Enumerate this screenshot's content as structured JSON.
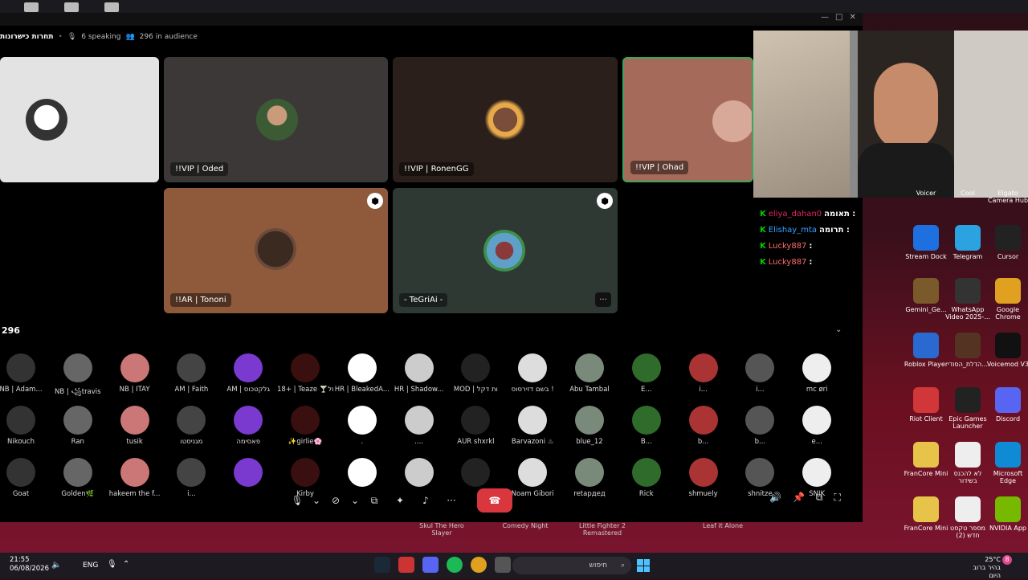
{
  "voice": {
    "channel_name": "תחרות כישרונות",
    "speaking": "6 speaking",
    "audience": "296 in audience"
  },
  "stage_tiles": [
    {
      "label": "",
      "bg": "#e3e3e3"
    },
    {
      "label": "!!VIP | Oded",
      "bg": "#3c3838"
    },
    {
      "label": "!!VIP | RonenGG",
      "bg": "#2a1f1a"
    },
    {
      "label": "!!VIP | Ohad",
      "bg": "#a66a5a"
    },
    {
      "label": "!!AR | Tononi",
      "bg": "#8f5a3c"
    },
    {
      "label": "- TeGriAi -",
      "bg": "#2f3934"
    }
  ],
  "audience_count": "296",
  "audience": [
    "NB | Adam...",
    "NB | ꧁travis",
    "NB | ITAY",
    "AM | Faith",
    "AM | גלקטכוס",
    "18+ | Teaze 🍸יזל",
    "HR | BleakedA...",
    "HR | Shadow...",
    "MOD | ות דקל",
    "בשם דזירסוס !",
    "Abu Tambal",
    "E...",
    "i...",
    "i...",
    "mc øri",
    "Nikouch",
    "Ran",
    "tusik",
    "מגניסטו",
    "פאסימה",
    "✨girlie🌸",
    ".",
    "....",
    "AUR shxrkl",
    "Barvazoni ♨",
    "blue_12",
    "B...",
    "b...",
    "b...",
    "e...",
    "Goat",
    "Golden🌿",
    "hakeem the f...",
    "i...",
    "",
    "Kirby",
    "",
    "",
    "",
    "Noam Gibori",
    "retapдед",
    "Rick",
    "shmuely",
    "shnitze",
    "SNIK"
  ],
  "chat": [
    {
      "badge": "תאומה :",
      "user": "eliya_dahan0",
      "color": "#e0245e"
    },
    {
      "badge": "תרומה :",
      "user": "Elishay_mta",
      "color": "#3aa0ff"
    },
    {
      "badge": ":",
      "user": "Lucky887",
      "color": "#ff6b6b"
    },
    {
      "badge": ":",
      "user": "Lucky887",
      "color": "#ff6b6b"
    }
  ],
  "desktop_icons": [
    {
      "label": "Voicer",
      "color": "#444"
    },
    {
      "label": "Cool",
      "color": "#444"
    },
    {
      "label": "Elgato Camera Hub",
      "color": "#333"
    },
    {
      "label": "Stream Dock",
      "color": "#1e6fe0"
    },
    {
      "label": "Telegram",
      "color": "#2aa3e0"
    },
    {
      "label": "Cursor",
      "color": "#222"
    },
    {
      "label": "Gemini_Ge...",
      "color": "#7a5a2a"
    },
    {
      "label": "WhatsApp Video 2025-...",
      "color": "#333"
    },
    {
      "label": "Google Chrome",
      "color": "#e0a020"
    },
    {
      "label": "Roblox Player",
      "color": "#2a6ad0"
    },
    {
      "label": "הדלת_הסודי...",
      "color": "#553322"
    },
    {
      "label": "Voicemod V3",
      "color": "#111"
    },
    {
      "label": "Riot Client",
      "color": "#d13639"
    },
    {
      "label": "Epic Games Launcher",
      "color": "#222"
    },
    {
      "label": "Discord",
      "color": "#5865f2"
    },
    {
      "label": "FranCore Mini",
      "color": "#e8c34a"
    },
    {
      "label": "לא להכנס בשידור",
      "color": "#eee"
    },
    {
      "label": "Microsoft Edge",
      "color": "#0f8ad4"
    },
    {
      "label": "FranCore Mini",
      "color": "#e8c34a"
    },
    {
      "label": "מספר טקסט חדש (2)",
      "color": "#eee"
    },
    {
      "label": "NVIDIA App",
      "color": "#76b900"
    }
  ],
  "game_titles": [
    "Skul The Hero Slayer",
    "Comedy Night",
    "Little Fighter 2 Remastered",
    "Leaf it Alone"
  ],
  "taskbar": {
    "time": "21:55",
    "date": "06/08/2026",
    "lang": "ENG",
    "search_placeholder": "חיפוש",
    "weather_temp": "25°C",
    "weather_desc": "בהיר ברוב היום",
    "notif": "8"
  },
  "colors": {
    "accent_green": "#3ba55c",
    "end_call": "#d9363e"
  }
}
